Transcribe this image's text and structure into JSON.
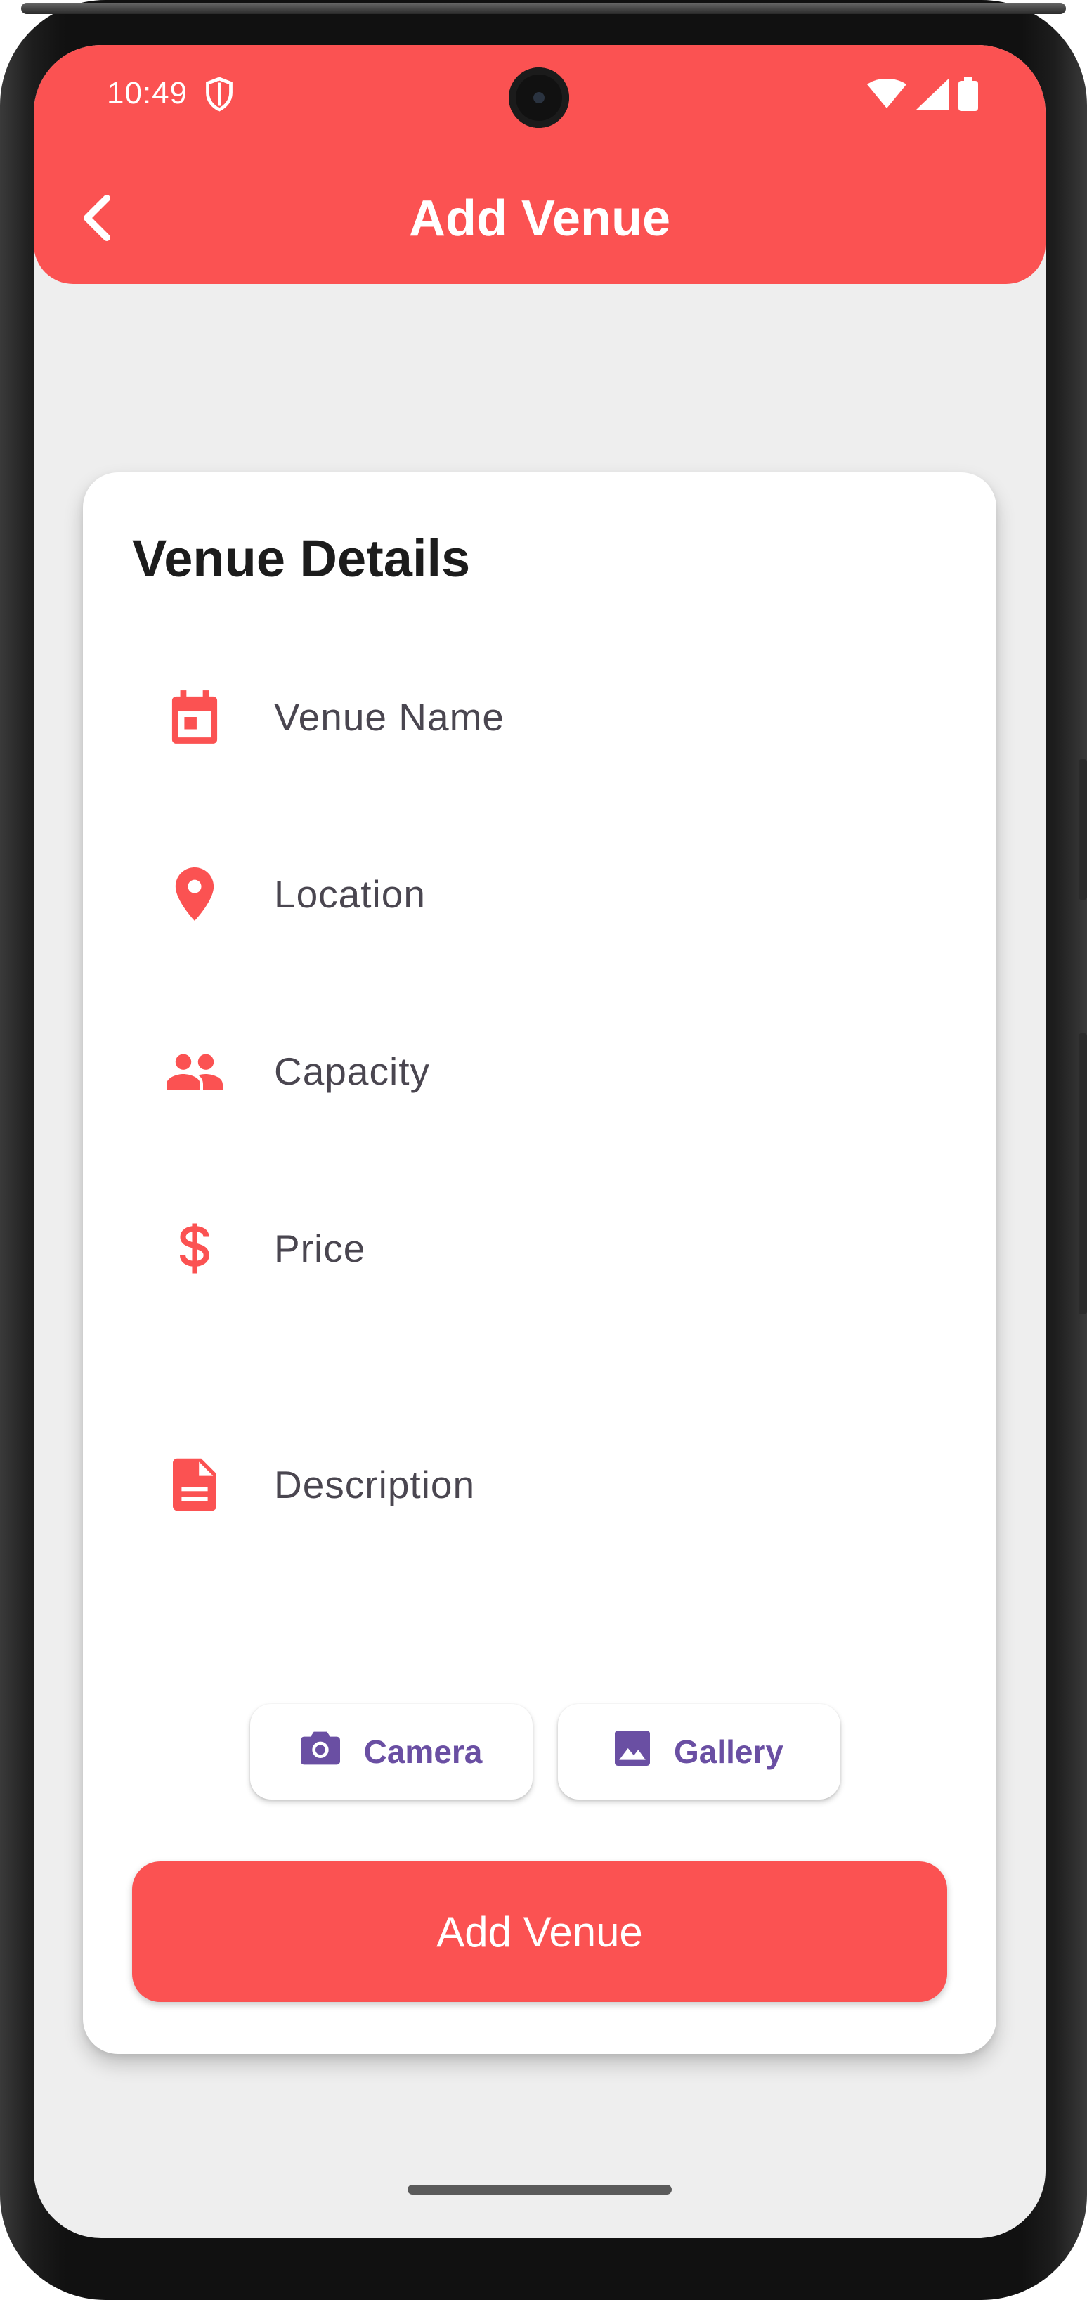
{
  "status_bar": {
    "time": "10:49",
    "icons": [
      "shield-icon",
      "wifi-icon",
      "signal-icon",
      "battery-icon"
    ]
  },
  "app_bar": {
    "title": "Add Venue",
    "back_icon": "chevron-left-icon",
    "background_color": "#fb5252"
  },
  "card": {
    "title": "Venue Details",
    "fields": [
      {
        "label": "Venue Name",
        "icon": "calendar-icon"
      },
      {
        "label": "Location",
        "icon": "location-pin-icon"
      },
      {
        "label": "Capacity",
        "icon": "people-icon"
      },
      {
        "label": "Price",
        "icon": "dollar-icon"
      },
      {
        "label": "Description",
        "icon": "document-icon"
      }
    ],
    "image_buttons": [
      {
        "label": "Camera",
        "icon": "camera-icon"
      },
      {
        "label": "Gallery",
        "icon": "image-icon"
      }
    ],
    "submit_label": "Add Venue"
  },
  "colors": {
    "accent": "#fb5252",
    "chip_text": "#6a4fa3",
    "screen_background": "#eeeeee"
  }
}
